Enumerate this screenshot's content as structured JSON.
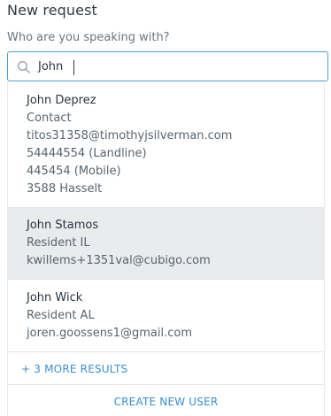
{
  "header": {
    "title": "New request",
    "field_label": "Who are you speaking with?"
  },
  "search": {
    "value": "John",
    "icon": "search-icon"
  },
  "results": [
    {
      "name": "John Deprez",
      "lines": [
        "Contact",
        "titos31358@timothyjsilverman.com",
        "54444554 (Landline)",
        "445454 (Mobile)",
        "3588 Hasselt"
      ],
      "highlighted": false
    },
    {
      "name": "John Stamos",
      "lines": [
        "Resident IL",
        "kwillems+1351val@cubigo.com"
      ],
      "highlighted": true
    },
    {
      "name": "John Wick",
      "lines": [
        "Resident AL",
        "joren.goossens1@gmail.com"
      ],
      "highlighted": false
    }
  ],
  "more_results_label": "+ 3 MORE RESULTS",
  "create_user_label": "CREATE NEW USER",
  "colors": {
    "accent": "#3a8fcf",
    "input_border": "#4a9fd8",
    "highlight": "#e9ebed"
  }
}
